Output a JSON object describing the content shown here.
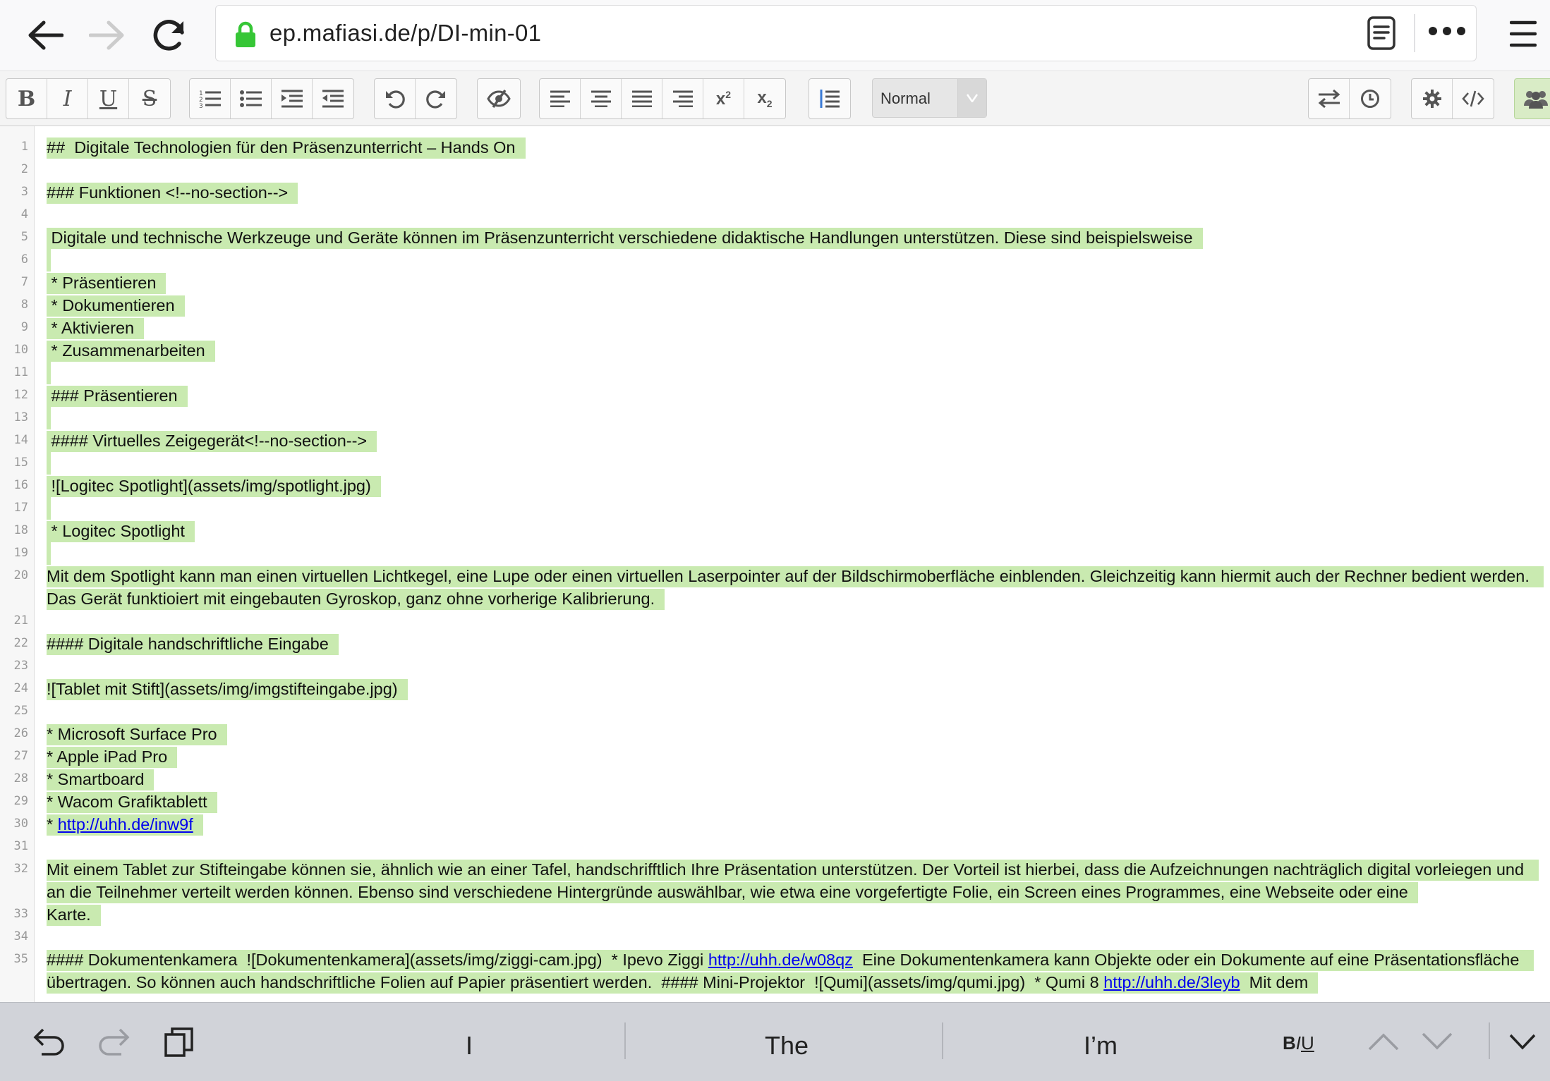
{
  "browser": {
    "url": "ep.mafiasi.de/p/DI-min-01",
    "icons": [
      "back-arrow-icon",
      "forward-arrow-icon",
      "reload-icon",
      "lock-icon",
      "reader-view-icon",
      "more-dots-icon",
      "hamburger-menu-icon"
    ]
  },
  "toolbar": {
    "format_select": "Normal",
    "colors": {
      "highlight": "#c9eab0",
      "link": "#0000ee"
    }
  },
  "editor": {
    "lines": [
      {
        "n": "1",
        "text": "##  Digitale Technologien für den Präsenzunterricht – Hands On"
      },
      {
        "n": "2",
        "text": ""
      },
      {
        "n": "3",
        "text": "### Funktionen <!--no-section-->"
      },
      {
        "n": "4",
        "text": ""
      },
      {
        "n": "5",
        "text": " Digitale und technische Werkzeuge und Geräte können im Präsenzunterricht verschiedene didaktische Handlungen unterstützen. Diese sind beispielsweise"
      },
      {
        "n": "6",
        "text": ""
      },
      {
        "n": "7",
        "text": " * Präsentieren"
      },
      {
        "n": "8",
        "text": " * Dokumentieren"
      },
      {
        "n": "9",
        "text": " * Aktivieren"
      },
      {
        "n": "10",
        "text": " * Zusammenarbeiten"
      },
      {
        "n": "11",
        "text": ""
      },
      {
        "n": "12",
        "text": " ### Präsentieren"
      },
      {
        "n": "13",
        "text": ""
      },
      {
        "n": "14",
        "text": " #### Virtuelles Zeigegerät<!--no-section-->"
      },
      {
        "n": "15",
        "text": ""
      },
      {
        "n": "16",
        "text": " ![Logitec Spotlight](assets/img/spotlight.jpg)"
      },
      {
        "n": "17",
        "text": ""
      },
      {
        "n": "18",
        "text": " * Logitec Spotlight"
      },
      {
        "n": "19",
        "text": ""
      },
      {
        "n": "20",
        "text": "Mit dem Spotlight kann man einen virtuellen Lichtkegel, eine Lupe oder einen virtuellen Laserpointer auf der Bildschirmoberfläche einblenden. Gleichzeitig kann hiermit auch der Rechner bedient werden. Das Gerät funktioiert mit eingebauten Gyroskop, ganz ohne vorherige Kalibrierung."
      },
      {
        "n": "21",
        "text": ""
      },
      {
        "n": "22",
        "text": "#### Digitale handschriftliche Eingabe"
      },
      {
        "n": "23",
        "text": ""
      },
      {
        "n": "24",
        "text": "![Tablet mit Stift](assets/img/imgstifteingabe.jpg)"
      },
      {
        "n": "25",
        "text": ""
      },
      {
        "n": "26",
        "text": "* Microsoft Surface Pro"
      },
      {
        "n": "27",
        "text": "* Apple iPad Pro"
      },
      {
        "n": "28",
        "text": "* Smartboard"
      },
      {
        "n": "29",
        "text": "* Wacom Grafiktablett"
      },
      {
        "n": "30",
        "prefix": "* ",
        "link": "http://uhh.de/inw9f"
      },
      {
        "n": "31",
        "text": ""
      },
      {
        "n": "32",
        "text": "Mit einem Tablet zur Stifteingabe können sie, ähnlich wie an einer Tafel, handschrifftlich Ihre Präsentation unterstützen. Der Vorteil ist hierbei, dass die Aufzeichnungen nachträglich digital vorleiegen und an die Teilnehmer verteilt werden können. Ebenso sind verschiedene Hintergründe auswählbar, wie etwa eine vorgefertigte Folie, ein Screen eines Programmes, eine Webseite oder eine"
      },
      {
        "n": "33",
        "text": "Karte."
      },
      {
        "n": "34",
        "text": ""
      },
      {
        "n": "35",
        "part1": "#### Dokumentenkamera  ![Dokumentenkamera](assets/img/ziggi-cam.jpg)  * Ipevo Ziggi ",
        "link1": "http://uhh.de/w08qz",
        "part2": "  Eine Dokumentenkamera kann Objekte oder ein Dokumente auf eine Präsentationsfläche übertragen. So können auch handschriftliche Folien auf Papier präsentiert werden.  #### Mini-Projektor  ![Qumi](assets/img/qumi.jpg)  * Qumi 8 ",
        "link2": "http://uhh.de/3leyb",
        "part3": "  Mit dem"
      }
    ]
  },
  "keyboard": {
    "suggestions": [
      "I",
      "The",
      "I’m"
    ],
    "format_label": "BIU"
  }
}
